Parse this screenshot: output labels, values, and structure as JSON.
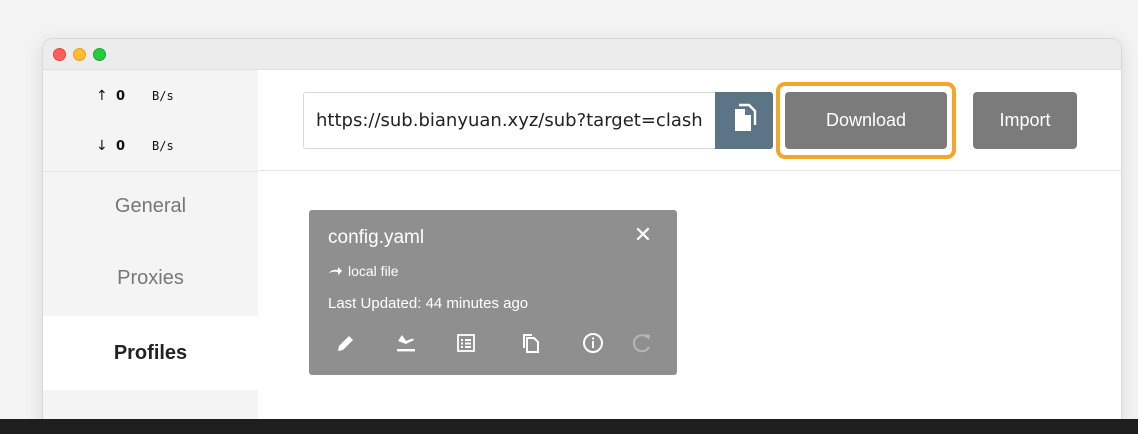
{
  "traffic": {
    "upload": {
      "arrow": "↑",
      "value": "0",
      "unit": "B/s"
    },
    "download": {
      "arrow": "↓",
      "value": "0",
      "unit": "B/s"
    }
  },
  "nav": {
    "general": "General",
    "proxies": "Proxies",
    "profiles": "Profiles"
  },
  "toolbar": {
    "url_value": "https://sub.bianyuan.xyz/sub?target=clash",
    "paste_icon": "paste-icon",
    "download_label": "Download",
    "import_label": "Import",
    "highlight_color": "#f4a62a"
  },
  "profile_card": {
    "name": "config.yaml",
    "type_label": "local file",
    "updated": "Last Updated: 44 minutes ago",
    "actions": [
      "edit-icon",
      "update-icon",
      "log-icon",
      "copy-icon",
      "info-icon",
      "refresh-icon"
    ]
  },
  "colors": {
    "sidebar_bg": "#f4f4f4",
    "button_gray": "#7b7b7b",
    "paste_blue": "#5b7486",
    "card_bg": "#8f8f8f"
  }
}
